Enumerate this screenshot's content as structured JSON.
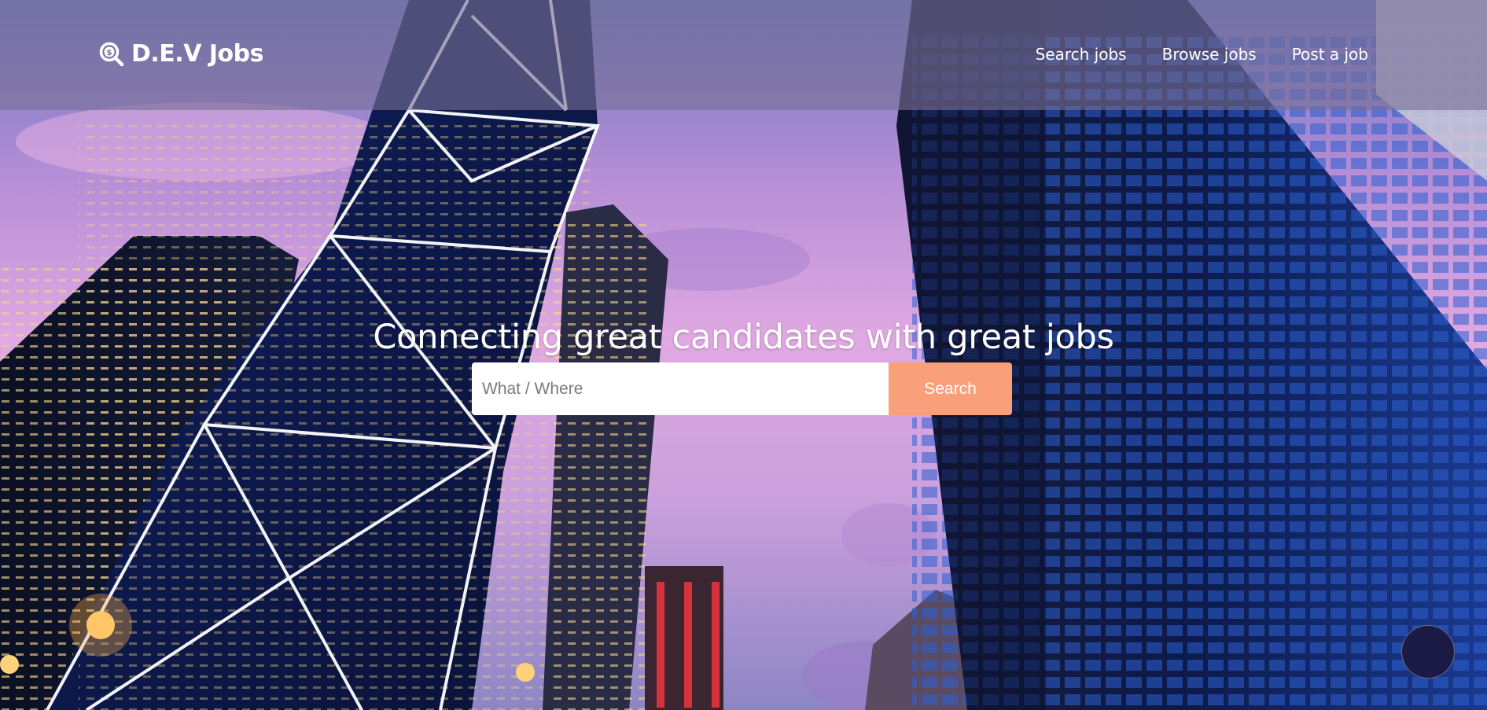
{
  "brand": {
    "name": "D.E.V Jobs",
    "icon": "search-dollar-icon"
  },
  "nav": {
    "items": [
      {
        "label": "Search jobs"
      },
      {
        "label": "Browse jobs"
      },
      {
        "label": "Post a job"
      }
    ]
  },
  "hero": {
    "headline": "Connecting great candidates with great jobs"
  },
  "search": {
    "placeholder": "What / Where",
    "value": "",
    "button_label": "Search"
  },
  "chat": {
    "icon": "chat-bubble-icon"
  },
  "colors": {
    "accent": "#f9a07a",
    "navbar_overlay": "#787096",
    "chat_bubble": "#1b1a45"
  }
}
